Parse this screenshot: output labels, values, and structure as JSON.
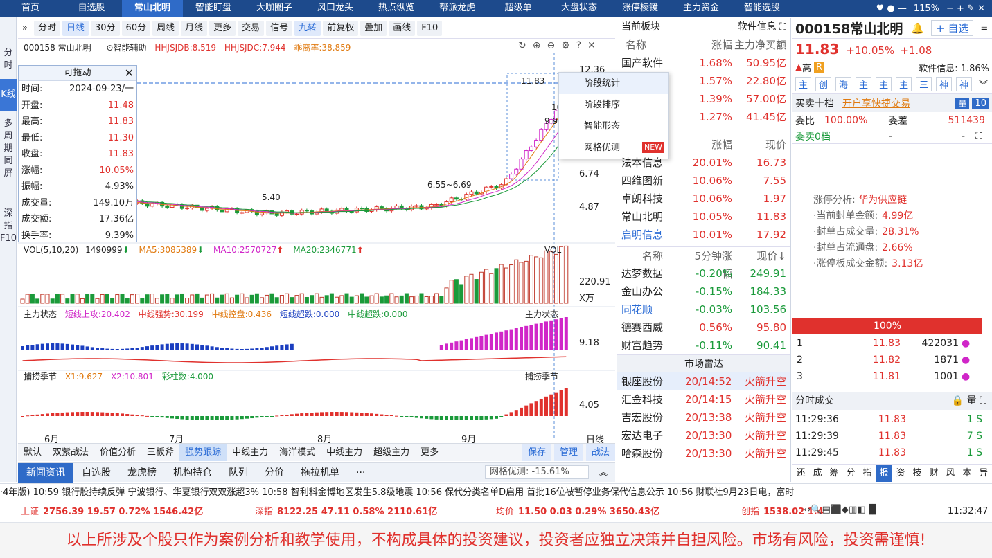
{
  "topbar": {
    "tabs": [
      "首页",
      "自选股",
      "常山北明",
      "智能盯盘",
      "大咖圈子",
      "风口龙头",
      "热点纵览",
      "帮派龙虎",
      "超级单",
      "大盘状态",
      "涨停棱镜",
      "主力资金",
      "智能选股"
    ],
    "active": 2,
    "zoom": "115%"
  },
  "leftbar": [
    "分时",
    "K线",
    "多周期同屏",
    "深指F10"
  ],
  "toolbar": {
    "items": [
      "分时",
      "日线",
      "30分",
      "60分",
      "周线",
      "月线",
      "更多",
      "交易",
      "信号",
      "九转",
      "前复权",
      "叠加",
      "画线",
      "F10"
    ],
    "active": [
      "日线",
      "九转"
    ]
  },
  "chart_header": {
    "code": "000158 常山北明",
    "assist": "智能辅助",
    "hhjsjdb": "HHJSJDB:8.519",
    "hhjsjdc": "HHJSJDC:7.944",
    "deviation": "乖离率:38.859"
  },
  "float_box": {
    "title": "可拖动",
    "rows": [
      {
        "k": "时间:",
        "v": "2024-09-23/一"
      },
      {
        "k": "开盘:",
        "v": "11.48"
      },
      {
        "k": "最高:",
        "v": "11.83"
      },
      {
        "k": "最低:",
        "v": "11.30"
      },
      {
        "k": "收盘:",
        "v": "11.83"
      },
      {
        "k": "涨幅:",
        "v": "10.05%"
      },
      {
        "k": "振幅:",
        "v": "4.93%"
      },
      {
        "k": "成交量:",
        "v": "149.10万"
      },
      {
        "k": "成交额:",
        "v": "17.36亿"
      },
      {
        "k": "换手率:",
        "v": "9.39%"
      }
    ]
  },
  "context_menu": [
    "阶段统计",
    "阶段排序",
    "智能形态",
    "网格优测"
  ],
  "context_menu_new": "NEW",
  "price_axis": [
    "12.36",
    "6.74",
    "4.87"
  ],
  "price_marks": {
    "high": "11.83",
    "mid": "9.99",
    "low_label": "5.40",
    "range": "6.55~6.69",
    "partial": "10"
  },
  "vol_header": {
    "name": "VOL(5,10,20)",
    "v": "1490999",
    "ma5": "MA5:3085389",
    "ma10": "MA10:2570727",
    "ma20": "MA20:2346771",
    "tag": "VOL"
  },
  "vol_axis": [
    "220.91",
    "X万"
  ],
  "main_header": {
    "name": "主力状态",
    "a": "短线上攻:20.402",
    "b": "中线强势:30.199",
    "c": "中线控盘:0.436",
    "d": "短线超跌:0.000",
    "e": "中线超跌:0.000",
    "tag": "主力状态"
  },
  "main_axis": "9.18",
  "season_header": {
    "name": "捕捞季节",
    "x1": "X1:9.627",
    "x2": "X2:10.801",
    "cz": "彩柱数:4.000",
    "tag": "捕捞季节"
  },
  "season_axis": "4.05",
  "months": [
    "6月",
    "7月",
    "8月",
    "9月"
  ],
  "period_label": "日线",
  "bottom_tabs": [
    "默认",
    "双紫战法",
    "价值分析",
    "三板斧",
    "强势跟踪",
    "中线主力",
    "海洋模式",
    "中线主力",
    "超级主力",
    "更多"
  ],
  "bottom_btns": [
    "保存",
    "管理",
    "战法"
  ],
  "news_tabs": [
    "新闻资讯",
    "自选股",
    "龙虎榜",
    "机构持仓",
    "队列",
    "分价",
    "拖拉机单",
    "···"
  ],
  "grid_eval": "网格优测: -15.61%",
  "ticker": "·4年版)    10:59 银行股持续反弹 宁波银行、华夏银行双双涨超3%    10:58 智利科金博地区发生5.8级地震    10:56 保代分类名单D启用 首批16位被暂停业务保代信息公示    10:56 财联社9月23日电，富时",
  "status": [
    {
      "n": "上证",
      "v": "2756.39  19.57  0.72%  1546.42亿"
    },
    {
      "n": "深指",
      "v": "8122.25  47.11  0.58%  2110.61亿"
    },
    {
      "n": "均价",
      "v": "11.50  0.03  0.29%  3650.43亿"
    },
    {
      "n": "创指",
      "v": "1538.02  1.4"
    }
  ],
  "clock": "11:32:47",
  "disclaimer": "以上所涉及个股只作为案例分析和教学使用，不构成具体的投资建议，投资者应独立决策并自担风险。市场有风险，投资需谨慎!",
  "mid": {
    "sector_title": "当前板块",
    "sector_tag": "软件信息",
    "sector_cols": [
      "名称",
      "涨幅",
      "主力净买额"
    ],
    "sectors": [
      {
        "n": "国产软件",
        "p": "1.68%",
        "v": "50.95亿"
      },
      {
        "n": "",
        "p": "1.57%",
        "v": "22.80亿"
      },
      {
        "n": "",
        "p": "1.39%",
        "v": "57.00亿"
      },
      {
        "n": "",
        "p": "1.27%",
        "v": "41.45亿"
      }
    ],
    "stock_cols": [
      "",
      "涨幅",
      "现价"
    ],
    "stocks": [
      {
        "n": "法本信息",
        "p": "20.01%",
        "v": "16.73"
      },
      {
        "n": "四维图新",
        "p": "10.06%",
        "v": "7.55"
      },
      {
        "n": "卓朗科技",
        "p": "10.06%",
        "v": "1.97"
      },
      {
        "n": "常山北明",
        "p": "10.05%",
        "v": "11.83"
      },
      {
        "n": "启明信息",
        "p": "10.01%",
        "v": "17.92"
      }
    ],
    "speed_cols": [
      "名称",
      "5分钟涨幅",
      "现价↓"
    ],
    "speed": [
      {
        "n": "达梦数据",
        "p": "-0.20%",
        "v": "249.91"
      },
      {
        "n": "金山办公",
        "p": "-0.15%",
        "v": "184.33"
      },
      {
        "n": "同花顺",
        "p": "-0.03%",
        "v": "103.56"
      },
      {
        "n": "德赛西威",
        "p": "0.56%",
        "v": "95.80"
      },
      {
        "n": "财富趋势",
        "p": "-0.11%",
        "v": "90.41"
      }
    ],
    "radar_title": "市场雷达",
    "radar": [
      {
        "n": "银座股份",
        "t": "20/14:52",
        "e": "火箭升空"
      },
      {
        "n": "汇金科技",
        "t": "20/14:15",
        "e": "火箭升空"
      },
      {
        "n": "吉宏股份",
        "t": "20/13:38",
        "e": "火箭升空"
      },
      {
        "n": "宏达电子",
        "t": "20/13:30",
        "e": "火箭升空"
      },
      {
        "n": "哈森股份",
        "t": "20/13:30",
        "e": "火箭升空"
      }
    ]
  },
  "right": {
    "title": "000158常山北明",
    "add": "+ 自选",
    "price": "11.83",
    "chg_pct": "+10.05%",
    "chg": "+1.08",
    "risk": "高",
    "r_badge": "R",
    "industry": "软件信息: 1.86%",
    "quick_tabs": [
      "主",
      "创",
      "海",
      "主",
      "主",
      "主",
      "三",
      "神",
      "神"
    ],
    "book_title": "买卖十档",
    "book_link": "开户享快捷交易",
    "book_num": "10",
    "weibi_k": "委比",
    "weibi_v": "100.00%",
    "weicha_k": "委差",
    "weicha_v": "511439",
    "sell0": "委卖0档",
    "analysis_title": "涨停分析:",
    "analysis_tag": "华为供应链",
    "analysis": [
      {
        "k": "·当前封单金额:",
        "v": "4.99亿"
      },
      {
        "k": "·封单占成交量:",
        "v": "28.31%"
      },
      {
        "k": "·封单占流通盘:",
        "v": "2.66%"
      },
      {
        "k": "·涨停板成交金额:",
        "v": "3.13亿"
      }
    ],
    "bar_pct": "100%",
    "bids": [
      {
        "i": "1",
        "p": "11.83",
        "v": "422031"
      },
      {
        "i": "2",
        "p": "11.82",
        "v": "1871"
      },
      {
        "i": "3",
        "p": "11.81",
        "v": "1001"
      }
    ],
    "ticks_title": "分时成交",
    "ticks": [
      {
        "t": "11:29:36",
        "p": "11.83",
        "v": "1 S"
      },
      {
        "t": "11:29:39",
        "p": "11.83",
        "v": "7 S"
      },
      {
        "t": "11:29:45",
        "p": "11.83",
        "v": "1 S"
      }
    ],
    "bottom_tabs": [
      "还",
      "成",
      "筹",
      "分",
      "指",
      "报",
      "资",
      "技",
      "财",
      "风",
      "本",
      "异"
    ]
  }
}
